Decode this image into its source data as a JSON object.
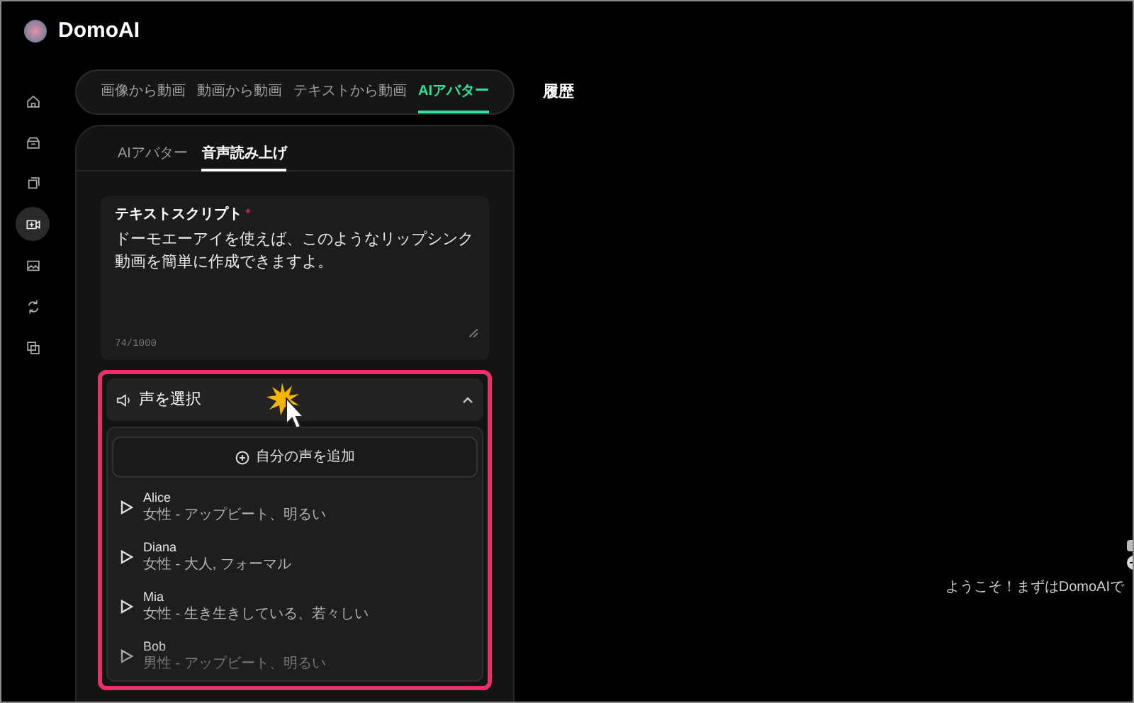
{
  "app": {
    "name": "DomoAI"
  },
  "sidebar": {
    "items": [
      {
        "selected": false
      },
      {
        "selected": false
      },
      {
        "selected": false
      },
      {
        "selected": true
      },
      {
        "selected": false
      },
      {
        "selected": false
      },
      {
        "selected": false
      }
    ]
  },
  "tabs": [
    {
      "label": "画像から動画",
      "selected": false
    },
    {
      "label": "動画から動画",
      "selected": false
    },
    {
      "label": "テキストから動画",
      "selected": false
    },
    {
      "label": "AIアバター",
      "selected": true
    }
  ],
  "history_link": "履歴",
  "sub_tabs": [
    {
      "label": "AIアバター",
      "selected": false
    },
    {
      "label": "音声読み上げ",
      "selected": true
    }
  ],
  "script": {
    "label": "テキストスクリプト",
    "required_mark": "*",
    "value": "ドーモエーアイを使えば、このようなリップシンク動画を簡単に作成できますよ。",
    "counter": "74/1000"
  },
  "voice_select": {
    "label": "声を選択",
    "expanded": true,
    "add_button": "自分の声を追加",
    "voices": [
      {
        "name": "Alice",
        "description": "女性 - アップビート、明るい"
      },
      {
        "name": "Diana",
        "description": "女性 - 大人, フォーマル"
      },
      {
        "name": "Mia",
        "description": "女性 - 生き生きしている、若々しい"
      },
      {
        "name": "Bob",
        "description": "男性 - アップビート、明るい"
      }
    ]
  },
  "welcome_text": "ようこそ！まずはDomoAIで"
}
